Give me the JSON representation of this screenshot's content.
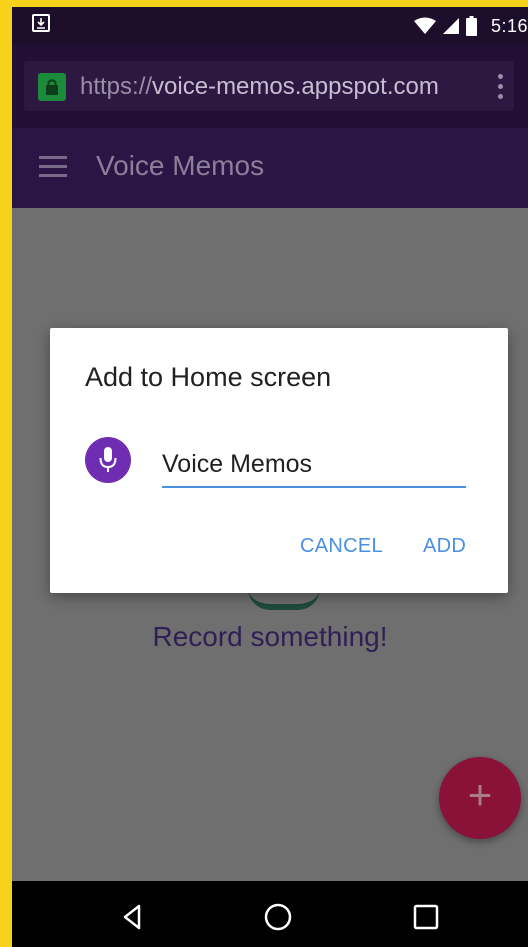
{
  "status_bar": {
    "time": "5:16",
    "icons": [
      "download-notification-icon",
      "wifi-icon",
      "cell-signal-icon",
      "battery-icon"
    ]
  },
  "browser": {
    "url_scheme": "https://",
    "url_host": "voice-memos.appspot.com",
    "icons": [
      "lock-icon",
      "overflow-menu-icon"
    ]
  },
  "app_bar": {
    "title": "Voice Memos",
    "icons": [
      "hamburger-menu-icon"
    ]
  },
  "content": {
    "empty_message": "Record something!",
    "fab_label": "+"
  },
  "dialog": {
    "title": "Add to Home screen",
    "name_value": "Voice Memos",
    "cancel_label": "CANCEL",
    "add_label": "ADD",
    "icons": [
      "microphone-icon"
    ]
  },
  "nav_bar": {
    "icons": [
      "back-icon",
      "home-icon",
      "recents-icon"
    ]
  },
  "colors": {
    "frame": "#f7d21b",
    "app_bar": "#2b1545",
    "dialog_accent": "#4a90e2",
    "app_icon": "#6f2db3",
    "fab": "#8a1238"
  }
}
